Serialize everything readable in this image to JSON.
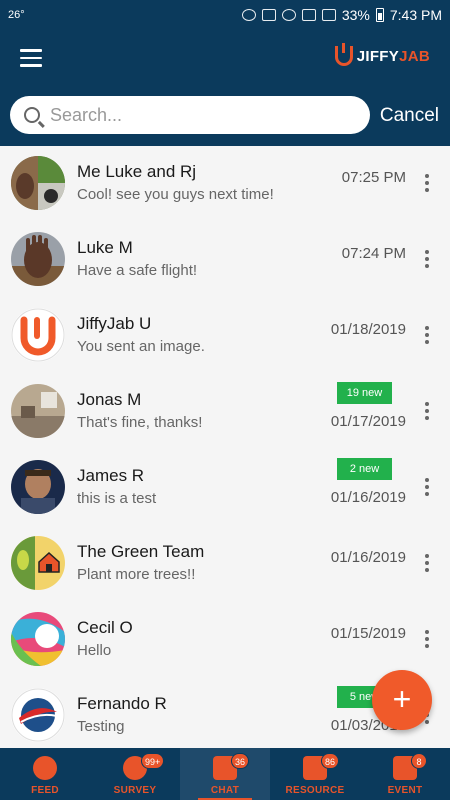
{
  "status_bar": {
    "temperature": "26°",
    "battery": "33%",
    "time": "7:43 PM"
  },
  "app_bar": {
    "logo_part1": "JIFFY",
    "logo_part2": "JAB"
  },
  "search": {
    "placeholder": "Search...",
    "value": "",
    "cancel_label": "Cancel"
  },
  "chats": [
    {
      "name": "Me Luke and Rj",
      "preview": "Cool! see you guys next time!",
      "time": "07:25 PM",
      "badge": ""
    },
    {
      "name": "Luke M",
      "preview": "Have a safe flight!",
      "time": "07:24 PM",
      "badge": ""
    },
    {
      "name": "JiffyJab U",
      "preview": "You sent an image.",
      "time": "01/18/2019",
      "badge": ""
    },
    {
      "name": "Jonas M",
      "preview": "That's fine, thanks!",
      "time": "01/17/2019",
      "badge": "19 new"
    },
    {
      "name": "James R",
      "preview": "this is a test",
      "time": "01/16/2019",
      "badge": "2 new"
    },
    {
      "name": "The Green Team",
      "preview": "Plant more trees!!",
      "time": "01/16/2019",
      "badge": ""
    },
    {
      "name": "Cecil O",
      "preview": "Hello",
      "time": "01/15/2019",
      "badge": ""
    },
    {
      "name": "Fernando R",
      "preview": "Testing",
      "time": "01/03/2019",
      "badge": "5 new"
    }
  ],
  "fab": {
    "icon": "plus-icon",
    "label": "+"
  },
  "bottom_nav": [
    {
      "label": "FEED",
      "count": "",
      "icon": "home-icon",
      "active": false
    },
    {
      "label": "SURVEY",
      "count": "99+",
      "icon": "survey-icon",
      "active": false
    },
    {
      "label": "CHAT",
      "count": "36",
      "icon": "chat-icon",
      "active": true
    },
    {
      "label": "RESOURCE",
      "count": "86",
      "icon": "folder-icon",
      "active": false
    },
    {
      "label": "EVENT",
      "count": "8",
      "icon": "calendar-icon",
      "active": false
    }
  ],
  "colors": {
    "primary": "#0b3a5c",
    "accent": "#e8542a",
    "badge_green": "#22b14c"
  }
}
